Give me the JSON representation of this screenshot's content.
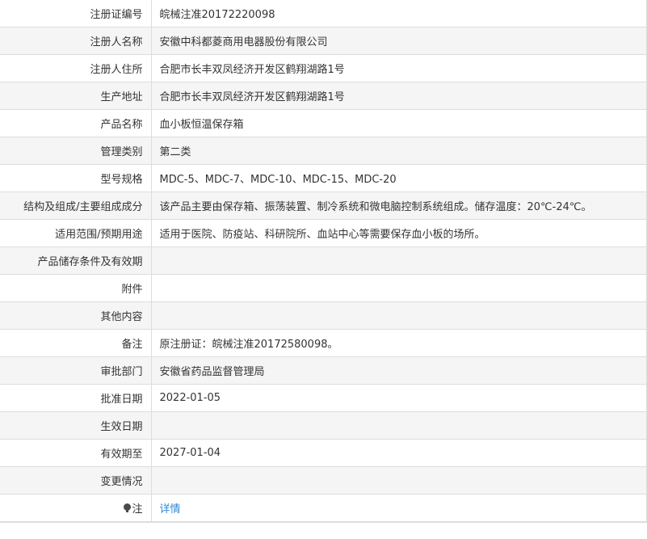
{
  "rows": [
    {
      "label": "注册证编号",
      "value": "皖械注准20172220098"
    },
    {
      "label": "注册人名称",
      "value": "安徽中科都菱商用电器股份有限公司"
    },
    {
      "label": "注册人住所",
      "value": "合肥市长丰双凤经济开发区鹤翔湖路1号"
    },
    {
      "label": "生产地址",
      "value": "合肥市长丰双凤经济开发区鹤翔湖路1号"
    },
    {
      "label": "产品名称",
      "value": "血小板恒温保存箱"
    },
    {
      "label": "管理类别",
      "value": "第二类"
    },
    {
      "label": "型号规格",
      "value": "MDC-5、MDC-7、MDC-10、MDC-15、MDC-20"
    },
    {
      "label": "结构及组成/主要组成成分",
      "value": "该产品主要由保存箱、振荡装置、制冷系统和微电脑控制系统组成。储存温度：20℃-24℃。"
    },
    {
      "label": "适用范围/预期用途",
      "value": "适用于医院、防疫站、科研院所、血站中心等需要保存血小板的场所。"
    },
    {
      "label": "产品储存条件及有效期",
      "value": ""
    },
    {
      "label": "附件",
      "value": ""
    },
    {
      "label": "其他内容",
      "value": ""
    },
    {
      "label": "备注",
      "value": "原注册证：皖械注准20172580098。"
    },
    {
      "label": "审批部门",
      "value": "安徽省药品监督管理局"
    },
    {
      "label": "批准日期",
      "value": "2022-01-05"
    },
    {
      "label": "生效日期",
      "value": ""
    },
    {
      "label": "有效期至",
      "value": "2027-01-04"
    },
    {
      "label": "变更情况",
      "value": ""
    }
  ],
  "note_row": {
    "label": "注",
    "icon": "lightbulb-icon",
    "link_text": "详情"
  },
  "colors": {
    "border": "#dddddd",
    "stripe": "#f5f5f5",
    "text": "#333333",
    "link": "#2b87d8"
  }
}
